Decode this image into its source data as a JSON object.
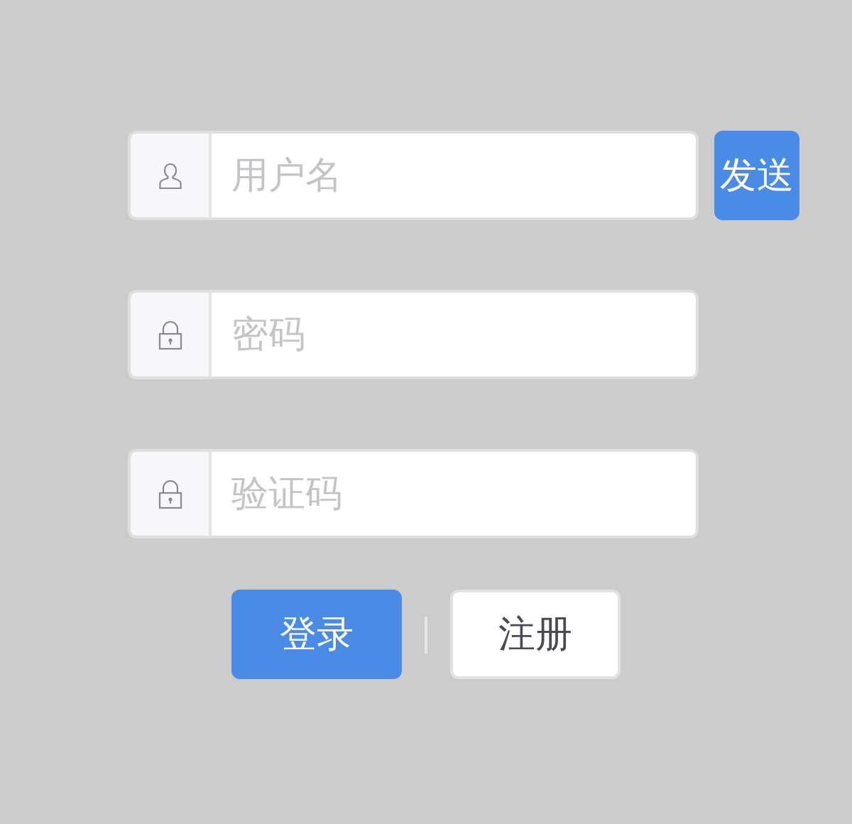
{
  "fields": [
    {
      "kind": "user",
      "placeholder": "用户名",
      "action": "发送"
    },
    {
      "kind": "lock",
      "placeholder": "密码"
    },
    {
      "kind": "lock",
      "placeholder": "验证码"
    }
  ],
  "buttons": [
    {
      "label": "登录",
      "kind": "primary"
    },
    {
      "label": "注册",
      "kind": "secondary"
    }
  ]
}
